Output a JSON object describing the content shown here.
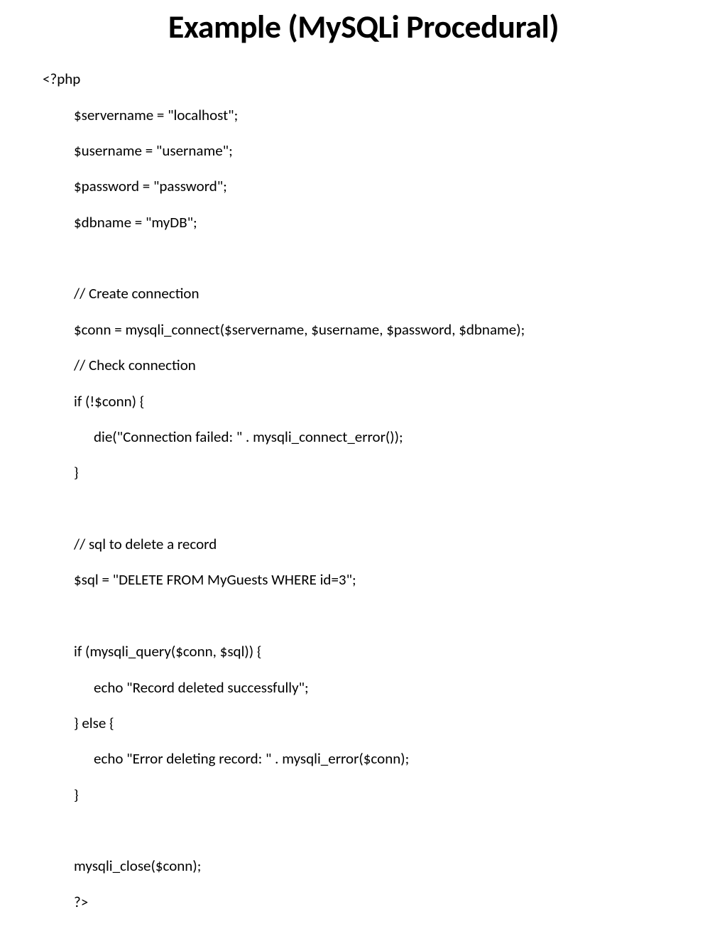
{
  "title": "Example (MySQLi Procedural)",
  "code": {
    "l1": "<?php",
    "l2": "$servername = \"localhost\";",
    "l3": "$username = \"username\";",
    "l4": "$password = \"password\";",
    "l5": "$dbname = \"myDB\";",
    "l6": "",
    "l7": "// Create connection",
    "l8": "$conn = mysqli_connect($servername, $username, $password, $dbname);",
    "l9": "// Check connection",
    "l10": "if (!$conn) {",
    "l11": "die(\"Connection failed: \" . mysqli_connect_error());",
    "l12": "}",
    "l13": "",
    "l14": "// sql to delete a record",
    "l15": "$sql = \"DELETE FROM MyGuests WHERE id=3\";",
    "l16": "",
    "l17": "if (mysqli_query($conn, $sql)) {",
    "l18": "echo \"Record deleted successfully\";",
    "l19": "} else {",
    "l20": "echo \"Error deleting record: \" . mysqli_error($conn);",
    "l21": "}",
    "l22": "",
    "l23": "mysqli_close($conn);",
    "l24": "?>"
  }
}
